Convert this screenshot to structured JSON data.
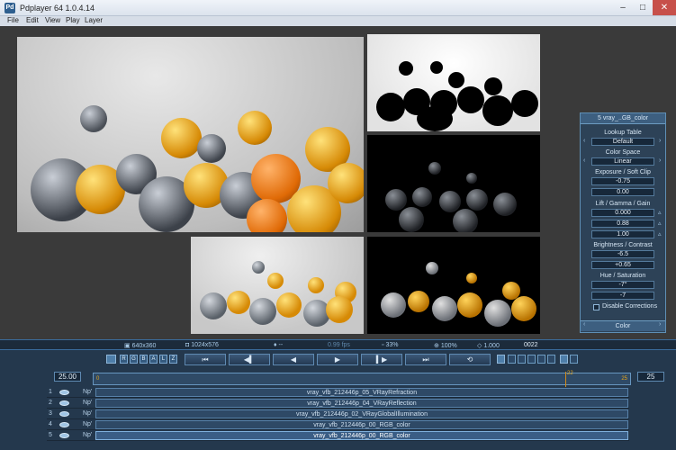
{
  "window": {
    "title": "Pdplayer 64 1.0.4.14",
    "app_icon": "Pd",
    "min": "–",
    "max": "□",
    "close": "✕"
  },
  "menu": [
    "File",
    "Edit",
    "View",
    "Play",
    "Layer"
  ],
  "panel": {
    "header": "5 vray_..GB_color",
    "lookup_label": "Lookup Table",
    "lookup_value": "Default",
    "colorspace_label": "Color Space",
    "colorspace_value": "Linear",
    "exposure_label": "Exposure / Soft Clip",
    "exposure": "-0.75",
    "softclip": "0.00",
    "lgg_label": "Lift / Gamma / Gain",
    "lift": "0.000",
    "gamma": "0.88",
    "gain": "1.00",
    "bc_label": "Brightness / Contrast",
    "brightness": "-6.5",
    "contrast": "+0.65",
    "hs_label": "Hue / Saturation",
    "hue": "-7°",
    "saturation": "-7",
    "disable_label": "Disable Corrections",
    "footer": "Color"
  },
  "status": {
    "resolution": "640x360",
    "canvas": "1024x576",
    "marker": "--",
    "fps": "0.99 fps",
    "zoom_pct": "33%",
    "zoom_view": "100%",
    "ratio": "1.000",
    "frame": "0022"
  },
  "toolbar": {
    "channels": [
      "R",
      "G",
      "B",
      "A",
      "L",
      "Z"
    ],
    "first": "⏮",
    "prev_key": "◀▍",
    "prev": "◀",
    "play": "▶",
    "next_key": "▍▶",
    "last": "⏭",
    "loop": "⟲"
  },
  "timeline": {
    "start": "25.00",
    "end": "25",
    "track_start": "0",
    "track_end": "25",
    "current": "22",
    "current_fraction": 0.88
  },
  "layers": [
    {
      "num": "1",
      "np": "Np'",
      "name": "vray_vfb_212446p_05_VRayRefraction"
    },
    {
      "num": "2",
      "np": "Np'",
      "name": "vray_vfb_212446p_04_VRayReflection"
    },
    {
      "num": "3",
      "np": "Np'",
      "name": "vray_vfb_212446p_02_VRayGlobalIllumination"
    },
    {
      "num": "4",
      "np": "Np'",
      "name": "vray_vfb_212446p_00_RGB_color"
    },
    {
      "num": "5",
      "np": "Np'",
      "name": "vray_vfb_212446p_00_RGB_color"
    }
  ],
  "colors": {
    "accent": "#6796c0",
    "amber": "#e6a417",
    "glass": "#6b6f76",
    "playhead": "#d18a1a"
  }
}
